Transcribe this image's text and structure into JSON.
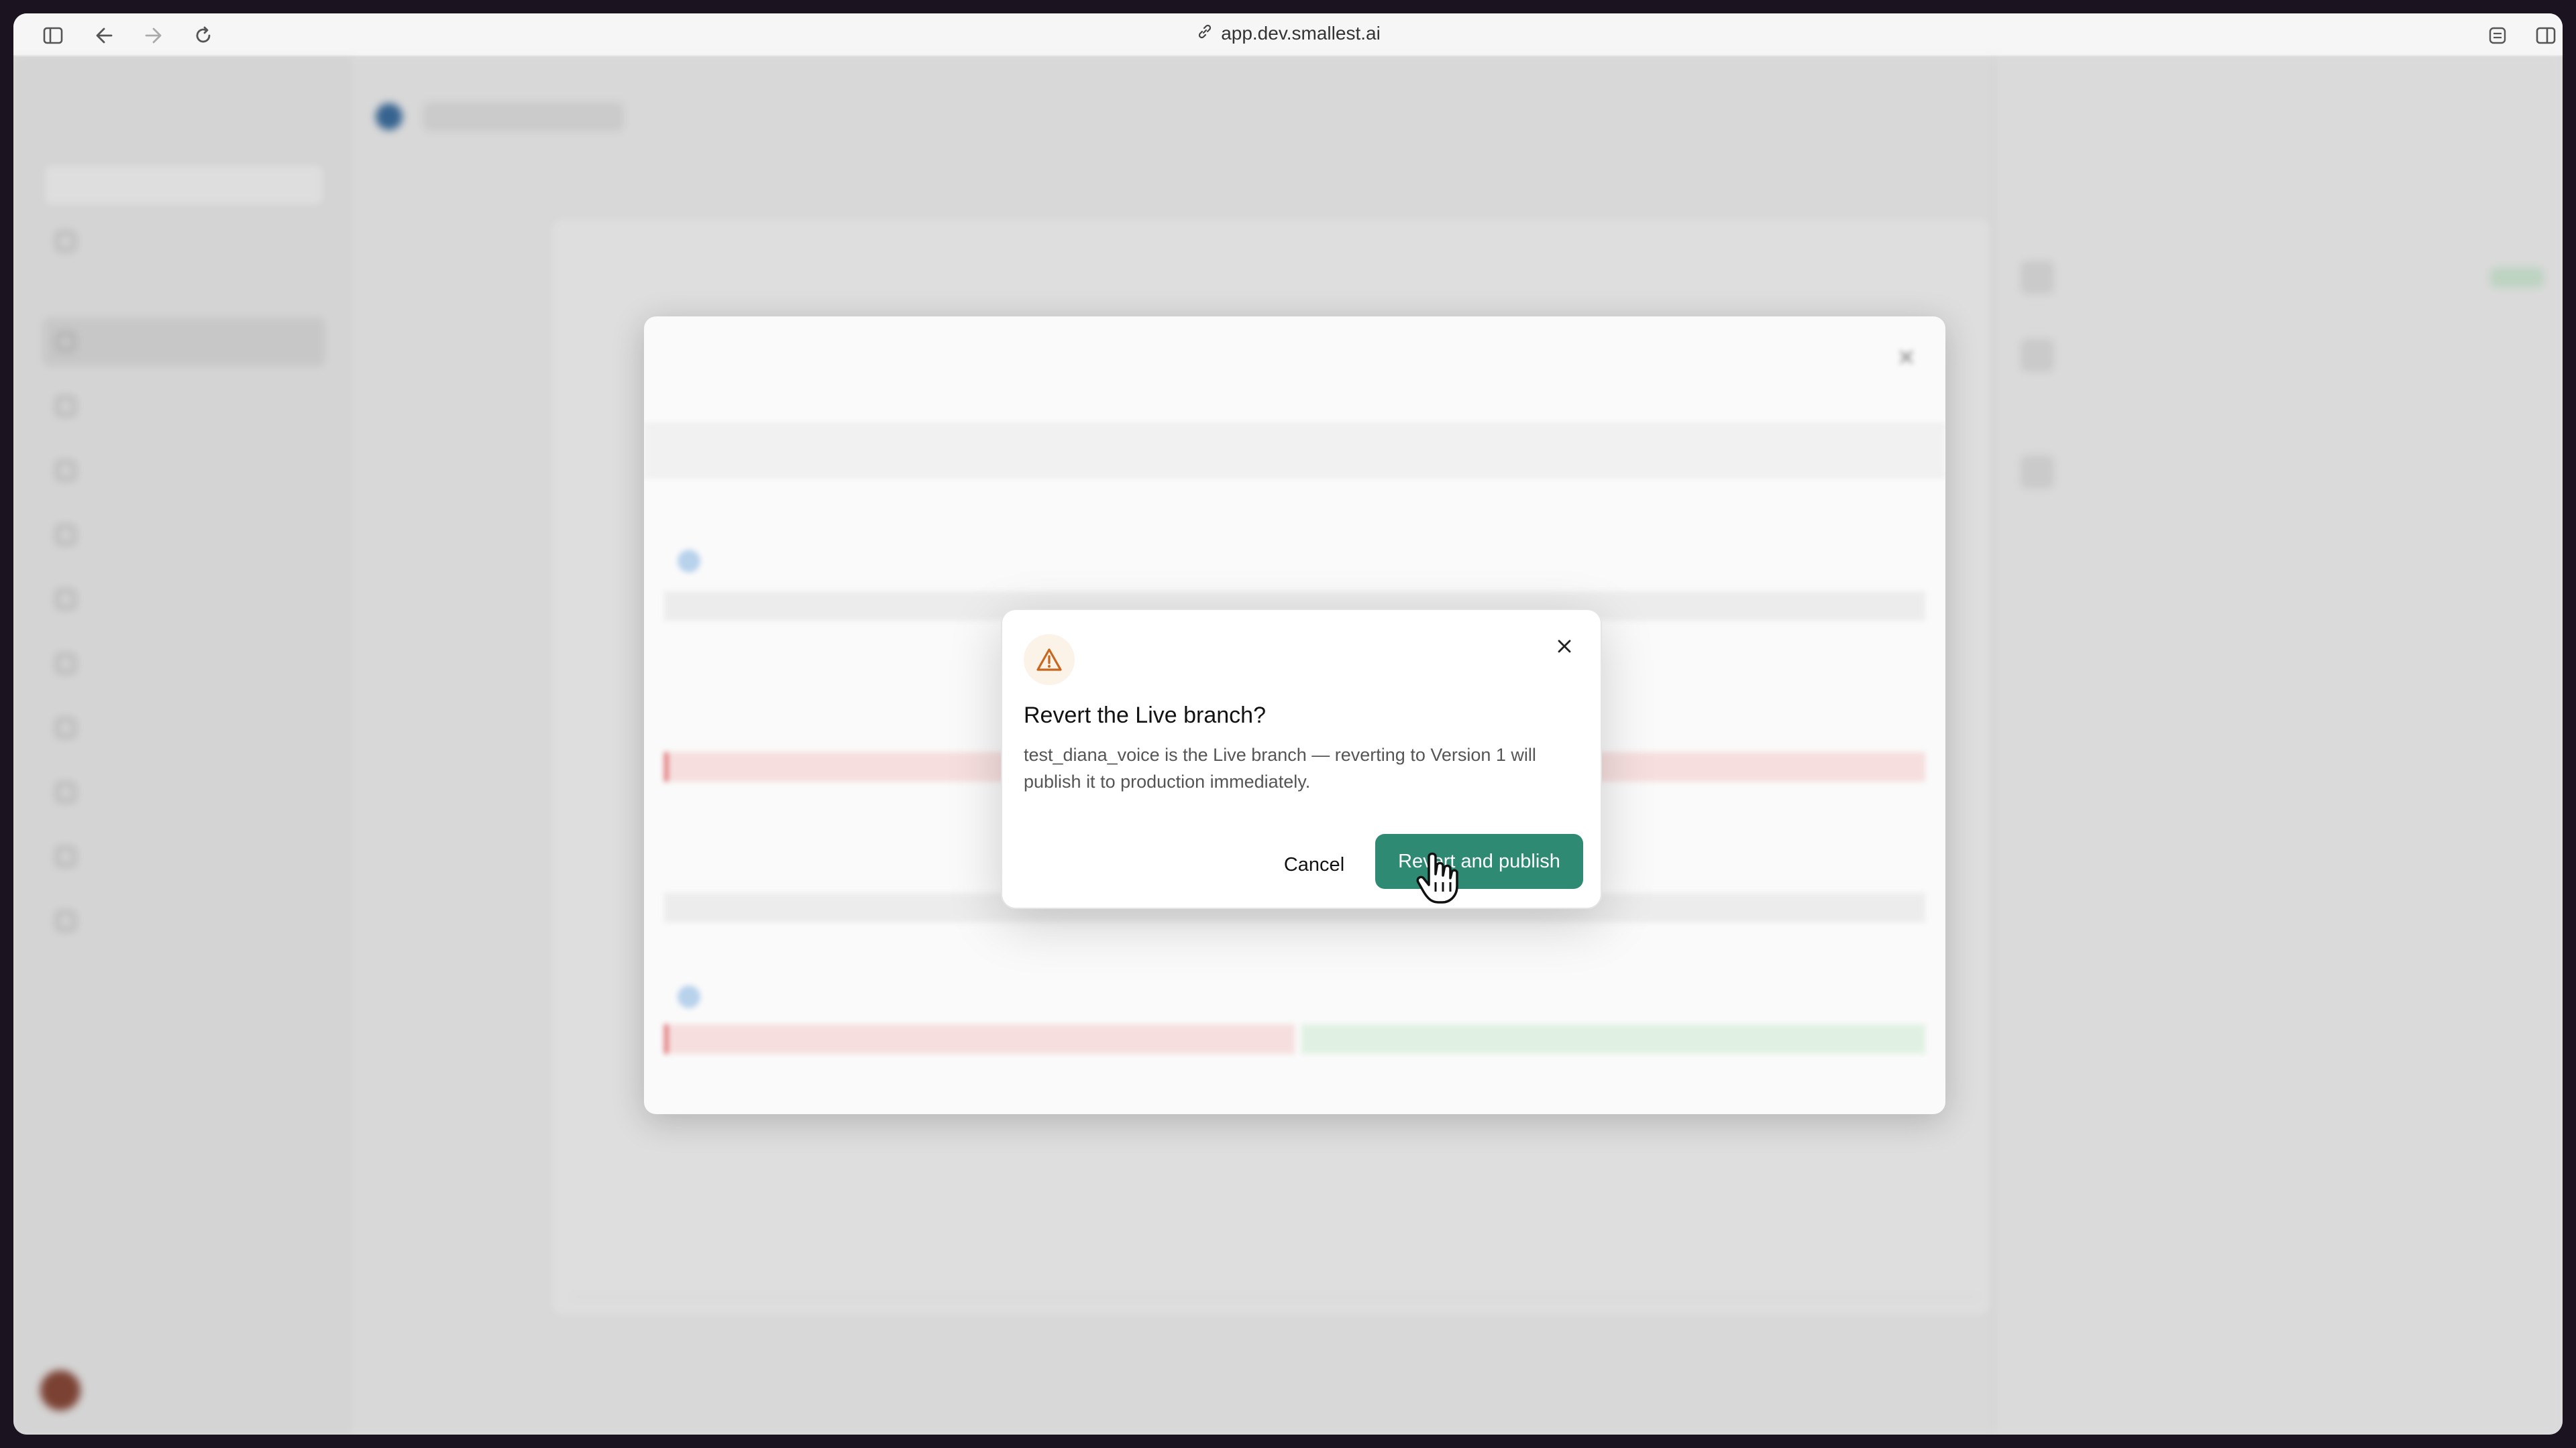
{
  "browser": {
    "url": "app.dev.smallest.ai"
  },
  "dialog": {
    "title": "Revert the Live branch?",
    "body": "test_diana_voice is the Live branch — reverting to Version 1 will publish it to production immediately.",
    "cancel_label": "Cancel",
    "confirm_label": "Revert and publish",
    "icon": "warning-icon",
    "accent_color": "#2f8a74",
    "warning_color": "#c8661e"
  }
}
